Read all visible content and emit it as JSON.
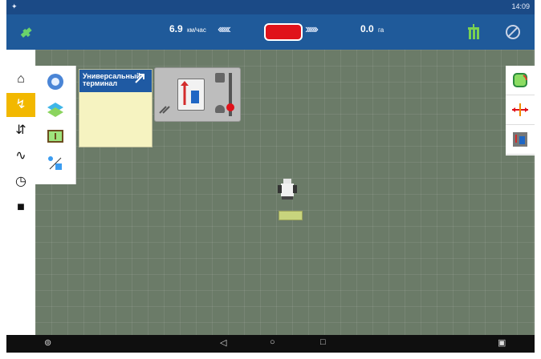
{
  "status": {
    "left_icon": "signal-icon",
    "right_text": "14:09"
  },
  "topbar": {
    "speed_value": "6.9",
    "speed_unit": "км/час",
    "area_value": "0.0",
    "area_unit": "га",
    "chevrons_left": "‹‹‹‹‹‹",
    "chevrons_right": "››››››"
  },
  "widget": {
    "title": "Универсальный терминал"
  },
  "colors": {
    "accent": "#1f5a9a",
    "alert": "#e0121a",
    "highlight": "#f2b800"
  },
  "android": {
    "back": "◁",
    "home": "○",
    "recents": "□"
  }
}
